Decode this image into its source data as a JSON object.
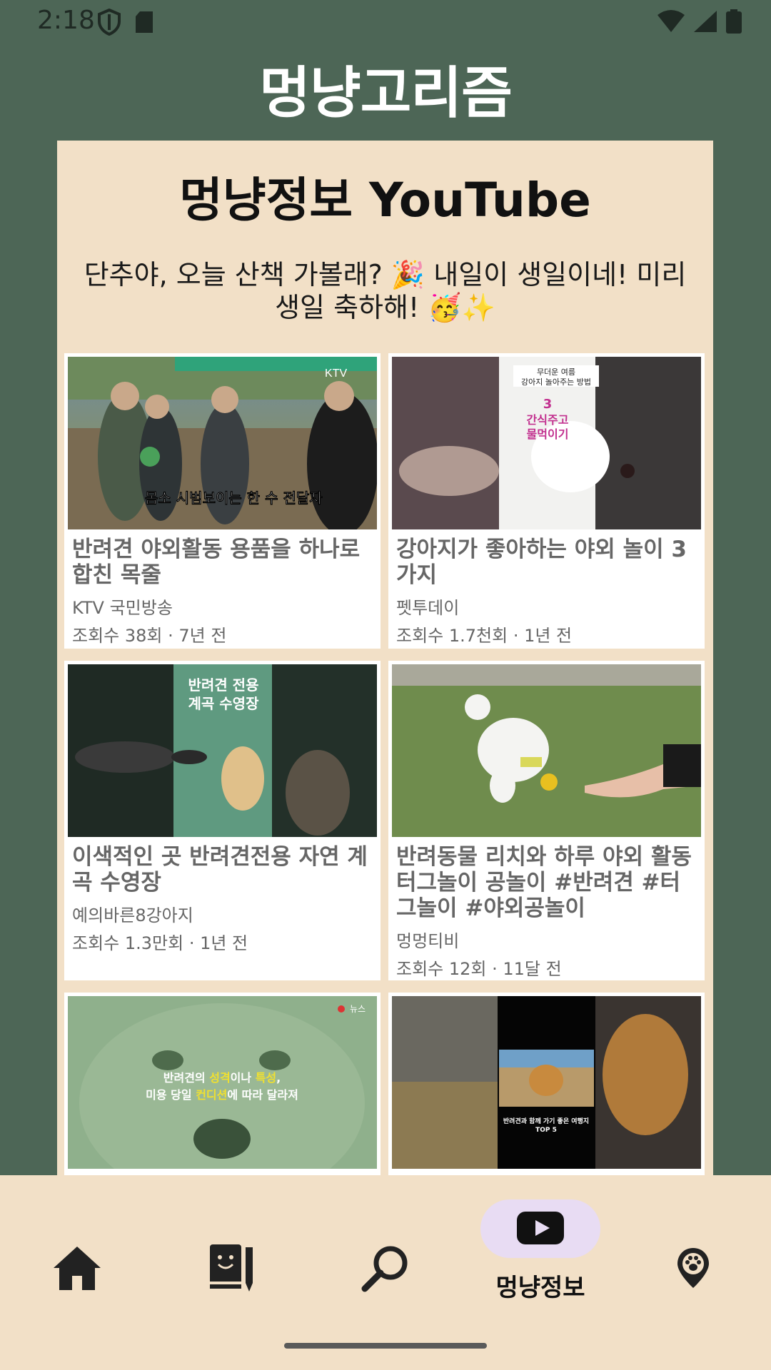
{
  "status_bar": {
    "time": "2:18",
    "icons": [
      "shield-icon",
      "sd-card-icon",
      "wifi-icon",
      "signal-icon",
      "battery-icon"
    ]
  },
  "app": {
    "title": "멍냥고리즘"
  },
  "section": {
    "title": "멍냥정보 YouTube",
    "greeting": "단추야, 오늘 산책 가볼래? 🎉 내일이 생일이네! 미리 생일 축하해! 🥳✨"
  },
  "videos": [
    {
      "title": "반려견 야외활동 용품을 하나로 합친 목줄",
      "channel": "KTV 국민방송",
      "meta": "조회수 38회 · 7년 전",
      "thumb_text": "몸소 시범보이는 한 수 전달자",
      "thumb_badge": "KTV"
    },
    {
      "title": "강아지가 좋아하는 야외 놀이 3가지",
      "channel": "펫투데이",
      "meta": "조회수 1.7천회 · 1년 전",
      "thumb_text_top": "무더운 여름\n강아지 놀아주는 방법",
      "thumb_text_mid": "3\n간식주고\n물먹이기"
    },
    {
      "title": "이색적인 곳 반려견전용 자연 계곡 수영장",
      "channel": "예의바른8강아지",
      "meta": "조회수 1.3만회 · 1년 전",
      "thumb_text": "반려견 전용\n계곡 수영장"
    },
    {
      "title": "반려동물 리치와 하루 야외 활동 터그놀이 공놀이 #반려견 #터그놀이 #야외공놀이",
      "channel": "멍멍티비",
      "meta": "조회수 12회 · 11달 전"
    },
    {
      "title": "",
      "channel": "",
      "meta": "",
      "thumb_text": "반려견의 성격이나 특성,\n미용 당일 컨디션에 따라 달라져",
      "thumb_badge": "뉴스"
    },
    {
      "title": "",
      "channel": "",
      "meta": "",
      "thumb_text": "반려견과 함께 가기 좋은 여행지\nTOP 5"
    }
  ],
  "bottom_nav": {
    "items": [
      "home-icon",
      "diary-icon",
      "search-icon",
      "youtube-icon",
      "paw-location-icon"
    ],
    "active_label": "멍냥정보"
  },
  "colors": {
    "background": "#4d6656",
    "panel": "#f2e0c7",
    "active_pill": "#e8dcf3"
  }
}
